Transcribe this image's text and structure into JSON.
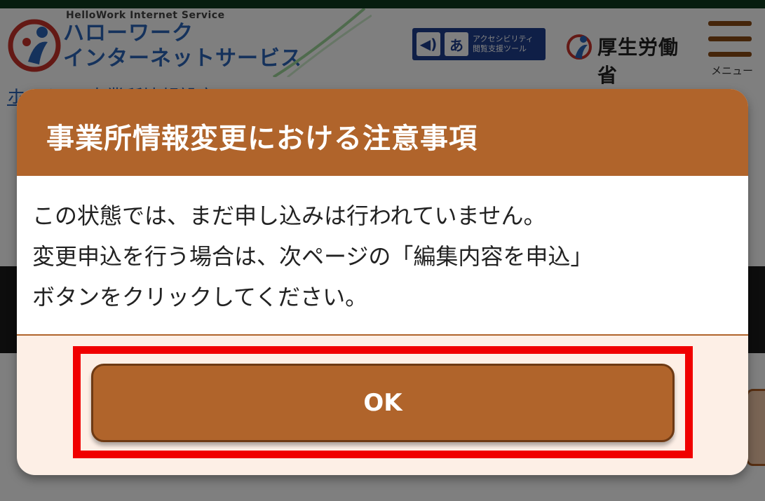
{
  "header": {
    "logo_subtitle": "HelloWork Internet Service",
    "logo_line1": "ハローワーク",
    "logo_line2": "インターネットサービス",
    "accessibility_label_line1": "アクセシビリティ",
    "accessibility_label_line2": "閲覧支援ツール",
    "ministry_name": "厚生労働省",
    "menu_label": "メニュー"
  },
  "breadcrumb": {
    "text": "ホーム > 事業所情報設定"
  },
  "modal": {
    "title": "事業所情報変更における注意事項",
    "body_lines": [
      "この状態では、まだ申し込みは行われていません。",
      "変更申込を行う場合は、次ページの「編集内容を申込」",
      "ボタンをクリックしてください。"
    ],
    "ok_label": "OK"
  },
  "colors": {
    "accent": "#b0642b",
    "highlight": "#f00000",
    "modal_background": "#fdefe6",
    "link": "#2a64b8"
  },
  "icons": {
    "logo": "hellowork-person-logo",
    "accessibility": "speaker-icon",
    "ministry": "ministry-logo-icon",
    "menu": "hamburger-icon"
  }
}
